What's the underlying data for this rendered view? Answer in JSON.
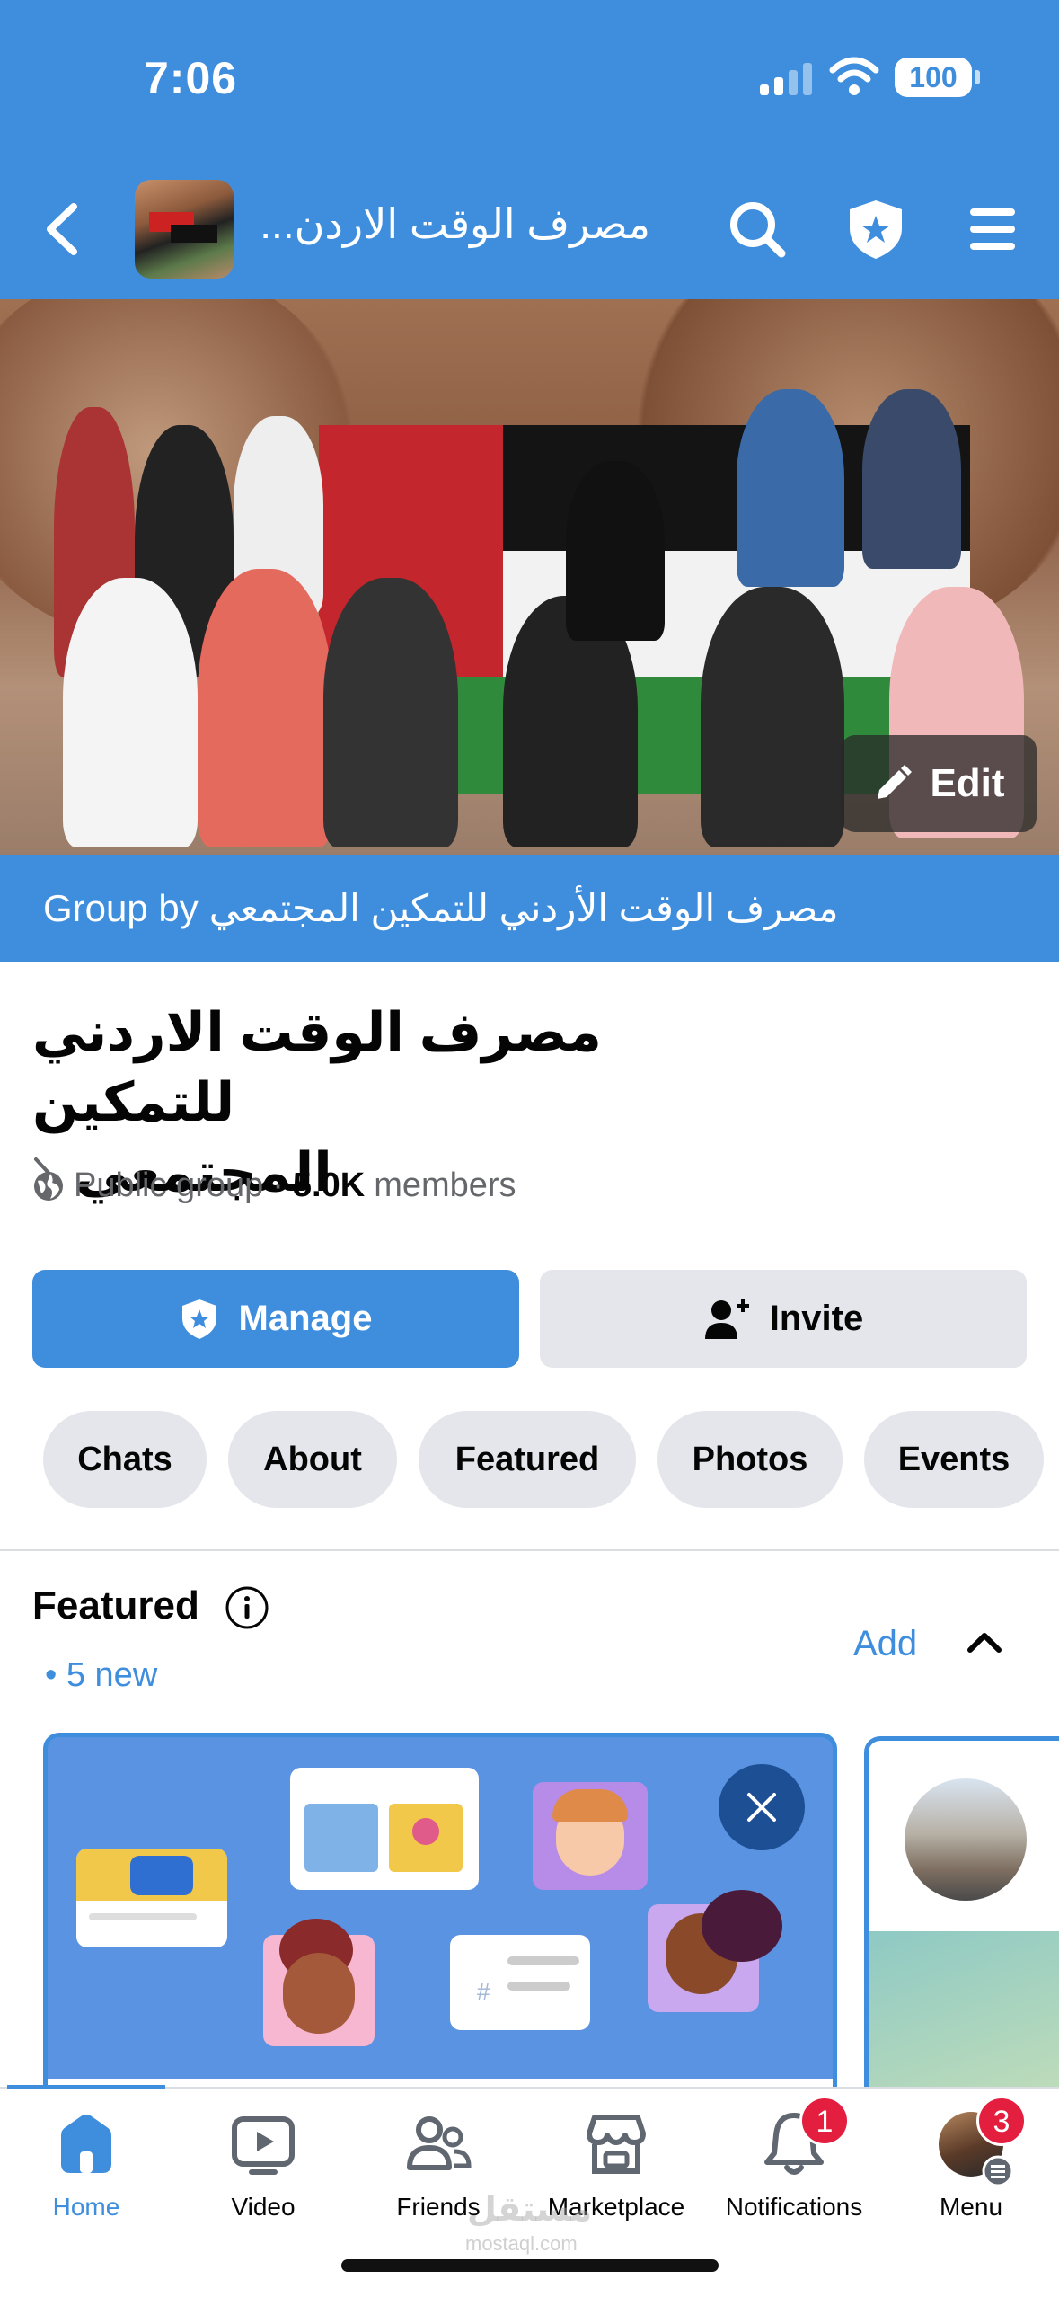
{
  "status_bar": {
    "time": "7:06",
    "battery": "100"
  },
  "header": {
    "title": "مصرف الوقت الاردن..."
  },
  "cover": {
    "edit_label": "Edit"
  },
  "group_by": {
    "prefix": "Group by",
    "name": "مصرف الوقت الأردني للتمكين المجتمعي"
  },
  "group": {
    "name_line1": "مصرف الوقت الاردني للتمكين",
    "name_line2": "المجتمعي",
    "privacy": "Public group",
    "separator": "·",
    "member_count": "5.0K",
    "members_label": "members"
  },
  "actions": {
    "manage": "Manage",
    "invite": "Invite"
  },
  "tabs": [
    "Chats",
    "About",
    "Featured",
    "Photos",
    "Events"
  ],
  "featured": {
    "title": "Featured",
    "new_badge": "• 5 new",
    "add": "Add"
  },
  "nav": {
    "items": [
      {
        "label": "Home"
      },
      {
        "label": "Video"
      },
      {
        "label": "Friends"
      },
      {
        "label": "Marketplace"
      },
      {
        "label": "Notifications",
        "badge": "1"
      },
      {
        "label": "Menu",
        "badge": "3"
      }
    ]
  },
  "watermark": {
    "brand": "مستقل",
    "domain": "mostaql.com"
  },
  "colors": {
    "accent": "#3f8ede",
    "badge": "#e41e3f",
    "pill": "#e4e6eb"
  }
}
